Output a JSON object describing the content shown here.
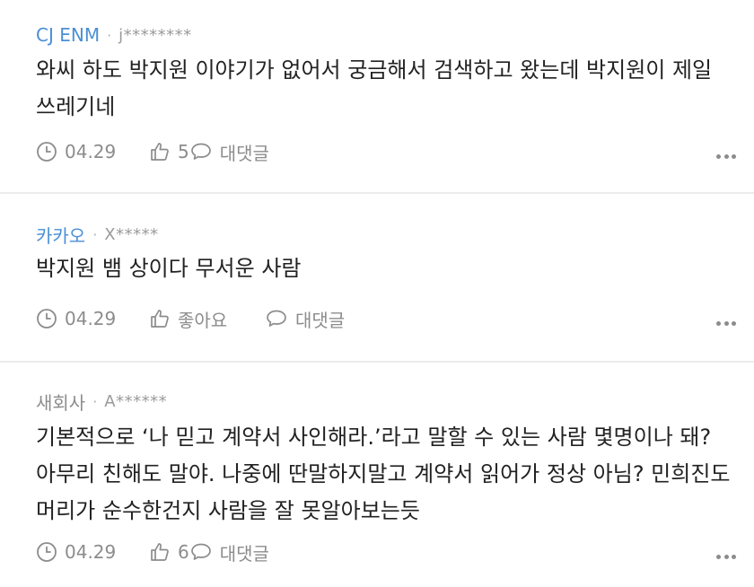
{
  "comments": [
    {
      "author": "CJ ENM",
      "user": "j********",
      "text": "와씨 하도 박지원 이야기가 없어서 궁금해서 검색하고 왔는데 박지원이 제일 쓰레기네",
      "date": "04.29",
      "likes": "5",
      "reply_label": "대댓글"
    },
    {
      "author": "카카오",
      "user": "X*****",
      "text": "박지원 뱀 상이다 무서운 사람",
      "date": "04.29",
      "likes": "좋아요",
      "reply_label": "대댓글"
    },
    {
      "author": "새회사",
      "user": "A******",
      "text": "기본적으로 ‘나 믿고 계약서 사인해라.’라고 말할 수 있는 사람 몇명이나 돼? 아무리 친해도 말야. 나중에 딴말하지말고 계약서 읽어가 정상 아님? 민희진도 머리가 순수한건지 사람을 잘 못알아보는듯",
      "date": "04.29",
      "likes": "6",
      "reply_label": "대댓글"
    }
  ],
  "separator": "·",
  "colors": {
    "brand_author": "#4a8fd6",
    "plain_author": "#8c8c8c",
    "meta": "#8c8c8c",
    "text": "#222222",
    "divider": "#ececec"
  },
  "icons": {
    "date": "clock-icon",
    "like": "thumbs-up-icon",
    "reply": "speech-bubble-icon",
    "more": "more-dots-icon"
  }
}
